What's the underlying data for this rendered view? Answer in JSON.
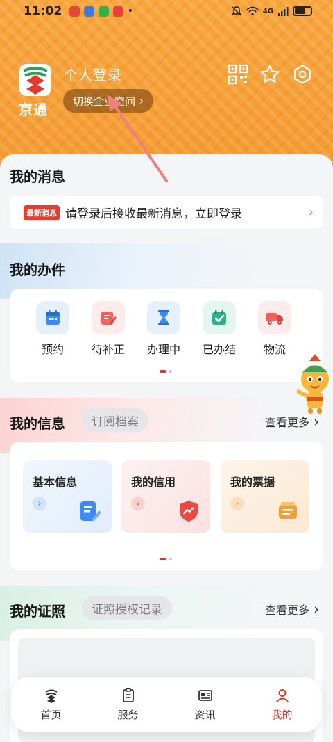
{
  "status_bar": {
    "time": "11:02",
    "network_label": "4G"
  },
  "header": {
    "app_name": "京通",
    "login_title": "个人登录",
    "switch_label": "切换企业空间"
  },
  "messages": {
    "title": "我的消息",
    "badge": "最新消息",
    "text": "请登录后接收最新消息，立即登录"
  },
  "work": {
    "title": "我的办件",
    "items": [
      {
        "label": "预约",
        "icon": "calendar-icon",
        "color": "#3b8cf0"
      },
      {
        "label": "待补正",
        "icon": "edit-icon",
        "color": "#f0625a"
      },
      {
        "label": "办理中",
        "icon": "hourglass-icon",
        "color": "#3b8cf0"
      },
      {
        "label": "已办结",
        "icon": "check-calendar-icon",
        "color": "#26b58a"
      },
      {
        "label": "物流",
        "icon": "truck-icon",
        "color": "#f0625a"
      }
    ]
  },
  "info": {
    "title": "我的信息",
    "sub_label": "订阅档案",
    "more_label": "查看更多",
    "tiles": [
      {
        "label": "基本信息",
        "icon": "document-edit-icon",
        "accent": "#3b8cf0"
      },
      {
        "label": "我的信用",
        "icon": "shield-icon",
        "accent": "#e94a45"
      },
      {
        "label": "我的票据",
        "icon": "ticket-icon",
        "accent": "#f0a030"
      }
    ]
  },
  "license": {
    "title": "我的证照",
    "sub_label": "证照授权记录",
    "more_label": "查看更多"
  },
  "tabbar": {
    "tabs": [
      {
        "label": "首页",
        "icon": "home-logo-icon",
        "active": false
      },
      {
        "label": "服务",
        "icon": "clipboard-icon",
        "active": false
      },
      {
        "label": "资讯",
        "icon": "news-icon",
        "active": false
      },
      {
        "label": "我的",
        "icon": "user-icon",
        "active": true
      }
    ]
  },
  "colors": {
    "brand_orange": "#f7a23a",
    "accent_red": "#d93a30"
  }
}
